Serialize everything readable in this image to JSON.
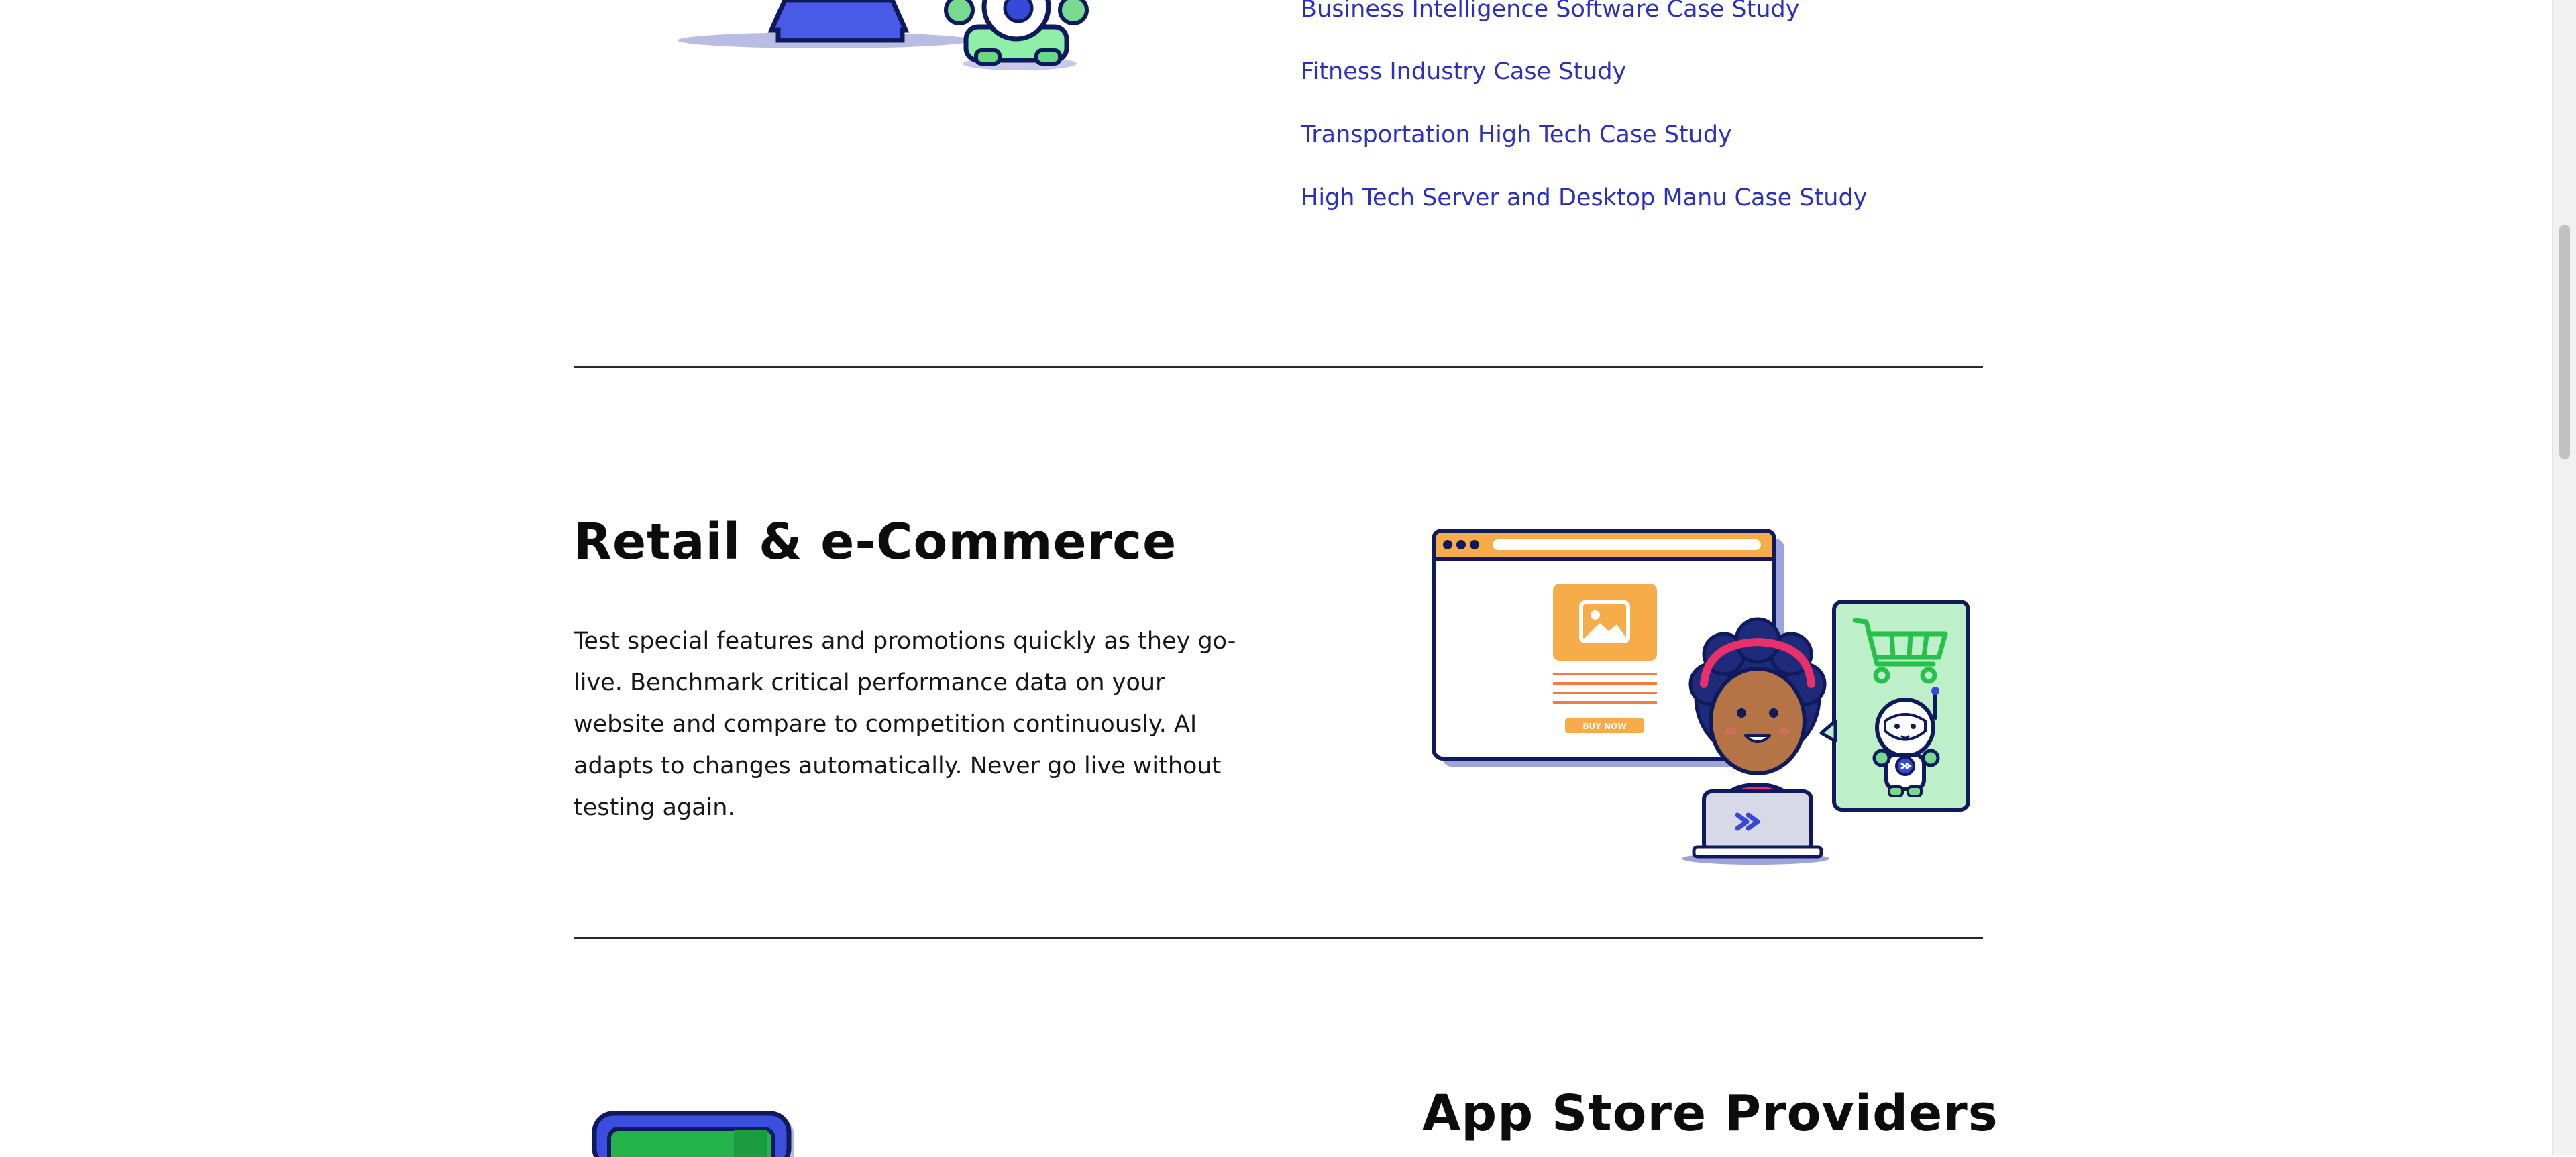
{
  "case_studies": {
    "links": [
      "Business Intelligence Software Case Study",
      "Fitness Industry Case Study",
      "Transportation High Tech Case Study",
      "High Tech Server and Desktop Manu Case Study"
    ]
  },
  "retail": {
    "title": "Retail & e-Commerce",
    "description": "Test special features and promotions quickly as they go-live. Benchmark critical performance data on your website and compare to competition continuously. AI adapts to changes automatically. Never go live without testing again.",
    "illustration": {
      "buy_label": "BUY NOW",
      "icons": [
        "image-icon",
        "shopping-cart-icon",
        "laptop-icon",
        "astronaut-mascot"
      ]
    }
  },
  "app_store": {
    "title": "App Store Providers"
  },
  "colors": {
    "link": "#2b2fbf",
    "accent_orange": "#f7ac4a",
    "accent_green": "#bdf0c8",
    "navy": "#0f1a5c",
    "blue": "#4658e6"
  }
}
